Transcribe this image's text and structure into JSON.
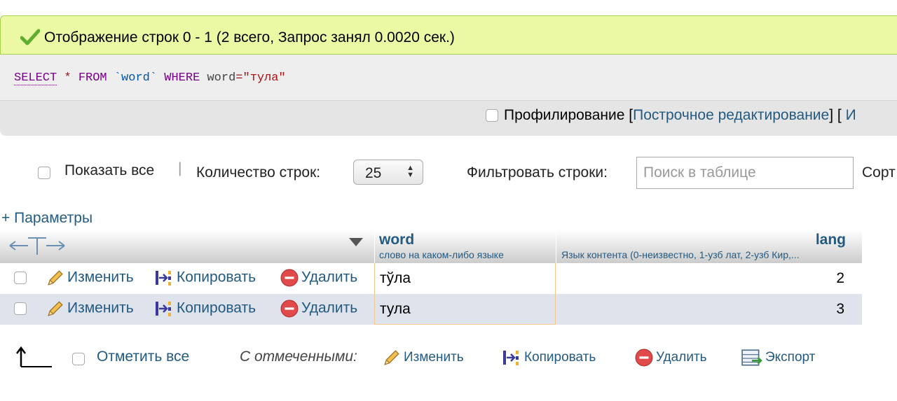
{
  "success": {
    "message": "Отображение строк 0 - 1 (2 всего, Запрос занял 0.0020 сек.)"
  },
  "sql": {
    "select": "SELECT",
    "star": "*",
    "from": "FROM",
    "table": "`word`",
    "where": "WHERE",
    "column": "word",
    "eq": "=",
    "value": "\"тула\""
  },
  "query_links": {
    "profiling": "Профилирование",
    "bracket_open": "[",
    "inline_edit": "Построчное редактирование",
    "bracket_close": "] [",
    "more": "И"
  },
  "controls": {
    "show_all": "Показать все",
    "separator": "|",
    "rows_label": "Количество строк:",
    "rows_value": "25",
    "filter_label": "Фильтровать строки:",
    "search_placeholder": "Поиск в таблице",
    "sort_label": "Сорт"
  },
  "options_link": "+ Параметры",
  "table": {
    "columns": [
      {
        "name": "word",
        "comment": "слово на каком-либо языке"
      },
      {
        "name": "lang",
        "comment": "Язык контента (0-неизвестно, 1-узб лат, 2-узб Кир,..."
      }
    ],
    "actions": {
      "edit": "Изменить",
      "copy": "Копировать",
      "delete": "Удалить"
    },
    "rows": [
      {
        "word": "тўла",
        "lang": "2"
      },
      {
        "word": "тула",
        "lang": "3"
      }
    ]
  },
  "bottom": {
    "check_all": "Отметить все",
    "with_selected": "С отмеченными:",
    "edit": "Изменить",
    "copy": "Копировать",
    "delete": "Удалить",
    "export": "Экспорт"
  },
  "colors": {
    "success_bg": "#ebf8a4",
    "link": "#235a81",
    "row_alt": "#dfe3ec",
    "highlight_border": "#f0c890"
  }
}
